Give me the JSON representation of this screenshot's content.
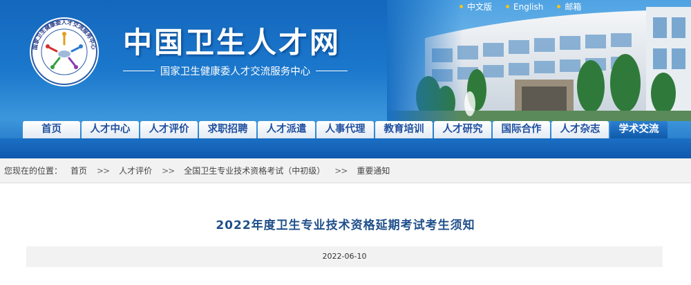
{
  "header": {
    "site_title": "中国卫生人才网",
    "site_subtitle": "国家卫生健康委人才交流服务中心",
    "logo_ring_text": "国家卫生健康委人才交流服务中心",
    "top_links": [
      {
        "label": "中文版"
      },
      {
        "label": "English"
      },
      {
        "label": "邮箱"
      }
    ]
  },
  "nav": {
    "items": [
      {
        "label": "首页"
      },
      {
        "label": "人才中心"
      },
      {
        "label": "人才评价"
      },
      {
        "label": "求职招聘"
      },
      {
        "label": "人才派遣"
      },
      {
        "label": "人事代理"
      },
      {
        "label": "教育培训"
      },
      {
        "label": "人才研究"
      },
      {
        "label": "国际合作"
      },
      {
        "label": "人才杂志"
      },
      {
        "label": "学术交流"
      }
    ],
    "active": "学术交流"
  },
  "breadcrumb": {
    "prefix": "您现在的位置：",
    "items": [
      {
        "label": "首页"
      },
      {
        "label": "人才评价"
      },
      {
        "label": "全国卫生专业技术资格考试（中初级）"
      },
      {
        "label": "重要通知"
      }
    ],
    "separator": ">>"
  },
  "article": {
    "title": "2022年度卫生专业技术资格延期考试考生须知",
    "date": "2022-06-10"
  },
  "colors": {
    "header_blue": "#1467bd",
    "nav_text": "#2050a0",
    "title_color": "#1f4f8a",
    "link_dot": "#f3c21c"
  }
}
